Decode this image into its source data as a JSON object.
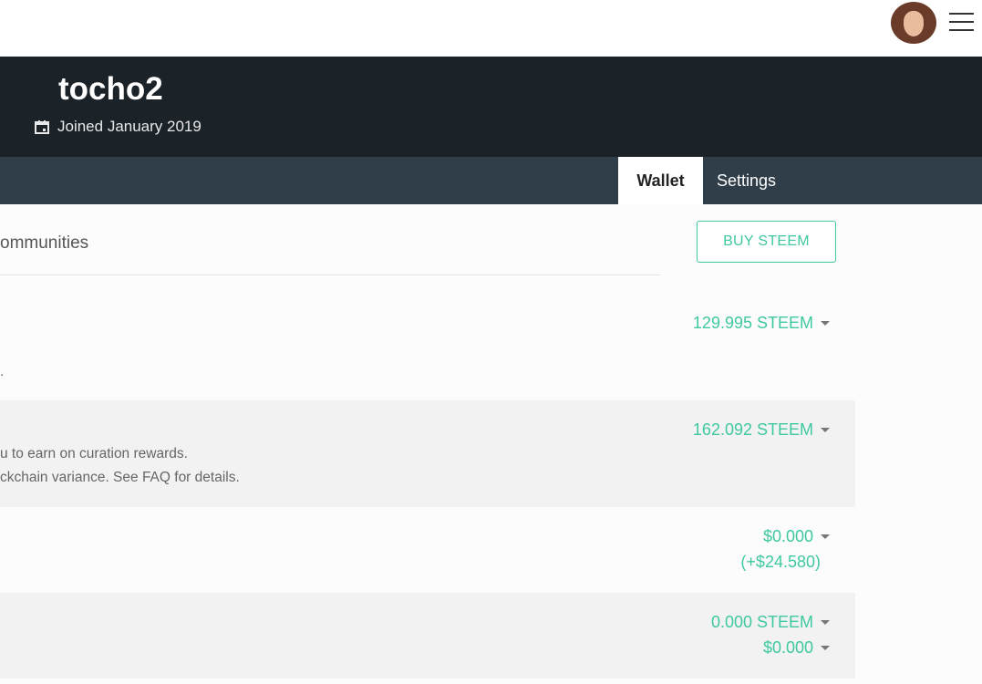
{
  "user": {
    "username": "tocho2",
    "joined": "Joined January 2019"
  },
  "tabs": {
    "wallet": "Wallet",
    "settings": "Settings"
  },
  "section": {
    "title": "ommunities",
    "buy_button": "BUY STEEM"
  },
  "rows": [
    {
      "text_lines": [
        ".",
        ""
      ],
      "amount": "129.995 STEEM"
    },
    {
      "text_lines": [
        "u to earn on curation rewards.",
        "ckchain variance. See FAQ for details."
      ],
      "amount": "162.092 STEEM"
    },
    {
      "amount": "$0.000",
      "sub_amount": "(+$24.580)"
    },
    {
      "amount": "0.000 STEEM",
      "amount2": "$0.000"
    }
  ],
  "icons": {
    "calendar": "calendar-icon",
    "menu": "hamburger-menu-icon",
    "caret": "caret-down-icon"
  },
  "colors": {
    "accent": "#3fc8a1",
    "header_bg": "#1b2228",
    "tabbar_bg": "#2f3e49"
  }
}
